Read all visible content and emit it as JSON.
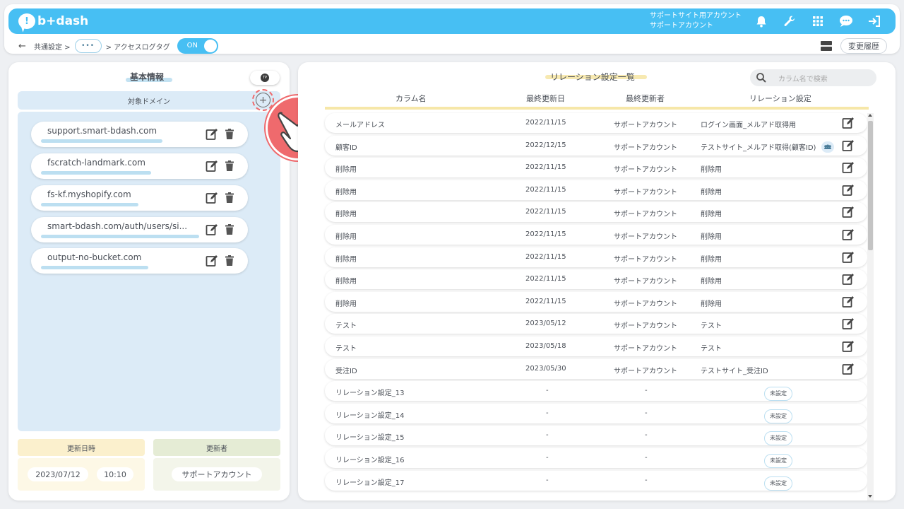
{
  "header": {
    "logo_text": "b+dash",
    "account_line1": "サポートサイト用アカウント",
    "account_line2": "サポートアカウント",
    "icons": [
      "bell-icon",
      "wrench-icon",
      "grid-icon",
      "chat-icon",
      "logout-icon"
    ]
  },
  "breadcrumb": {
    "back_icon": "arrow-left-icon",
    "item1": "共通設定 >",
    "ellipsis": "•••",
    "item2": "> アクセスログタグ",
    "toggle_label": "ON"
  },
  "header_right": {
    "history_label": "変更履歴",
    "layout_icon": "layout-rows-icon"
  },
  "left": {
    "title": "基本情報",
    "target_domain_label": "対象ドメイン",
    "add_icon": "plus-circle-icon",
    "domains": [
      "support.smart-bdash.com",
      "fscratch-landmark.com",
      "fs-kf.myshopify.com",
      "smart-bdash.com/auth/users/si...",
      "output-no-bucket.com"
    ],
    "updated_at_label": "更新日時",
    "updated_by_label": "更新者",
    "updated_date": "2023/07/12",
    "updated_time": "10:10",
    "updated_by": "サポートアカウント",
    "tp_badge": "TP"
  },
  "right": {
    "title": "リレーション設定一覧",
    "search_placeholder": "カラム名で検索",
    "columns": {
      "name": "カラム名",
      "date": "最終更新日",
      "user": "最終更新者",
      "relation": "リレーション設定"
    },
    "unset_label": "未設定",
    "rows": [
      {
        "name": "メールアドレス",
        "date": "2022/11/15",
        "user": "サポートアカウント",
        "relation": "ログイン画面_メルアド取得用"
      },
      {
        "name": "顧客ID",
        "date": "2022/12/15",
        "user": "サポートアカウント",
        "relation": "テストサイト_メルアド取得(顧客ID)"
      },
      {
        "name": "削除用",
        "date": "2022/11/15",
        "user": "サポートアカウント",
        "relation": "削除用"
      },
      {
        "name": "削除用",
        "date": "2022/11/15",
        "user": "サポートアカウント",
        "relation": "削除用"
      },
      {
        "name": "削除用",
        "date": "2022/11/15",
        "user": "サポートアカウント",
        "relation": "削除用"
      },
      {
        "name": "削除用",
        "date": "2022/11/15",
        "user": "サポートアカウント",
        "relation": "削除用"
      },
      {
        "name": "削除用",
        "date": "2022/11/15",
        "user": "サポートアカウント",
        "relation": "削除用"
      },
      {
        "name": "削除用",
        "date": "2022/11/15",
        "user": "サポートアカウント",
        "relation": "削除用"
      },
      {
        "name": "削除用",
        "date": "2022/11/15",
        "user": "サポートアカウント",
        "relation": "削除用"
      },
      {
        "name": "テスト",
        "date": "2023/05/12",
        "user": "サポートアカウント",
        "relation": "テスト"
      },
      {
        "name": "テスト",
        "date": "2023/05/18",
        "user": "サポートアカウント",
        "relation": "テスト"
      },
      {
        "name": "受注ID",
        "date": "2023/05/30",
        "user": "サポートアカウント",
        "relation": "テストサイト_受注ID"
      },
      {
        "name": "リレーション設定_13",
        "date": "-",
        "user": "-",
        "relation": ""
      },
      {
        "name": "リレーション設定_14",
        "date": "-",
        "user": "-",
        "relation": ""
      },
      {
        "name": "リレーション設定_15",
        "date": "-",
        "user": "-",
        "relation": ""
      },
      {
        "name": "リレーション設定_16",
        "date": "-",
        "user": "-",
        "relation": ""
      },
      {
        "name": "リレーション設定_17",
        "date": "-",
        "user": "-",
        "relation": ""
      }
    ]
  },
  "colors": {
    "brand": "#47bff3",
    "pointer": "#ef6a6d",
    "domain_bg": "#dcebf7",
    "date_bg": "#fbf0cd",
    "user_bg": "#e5ecd5"
  }
}
